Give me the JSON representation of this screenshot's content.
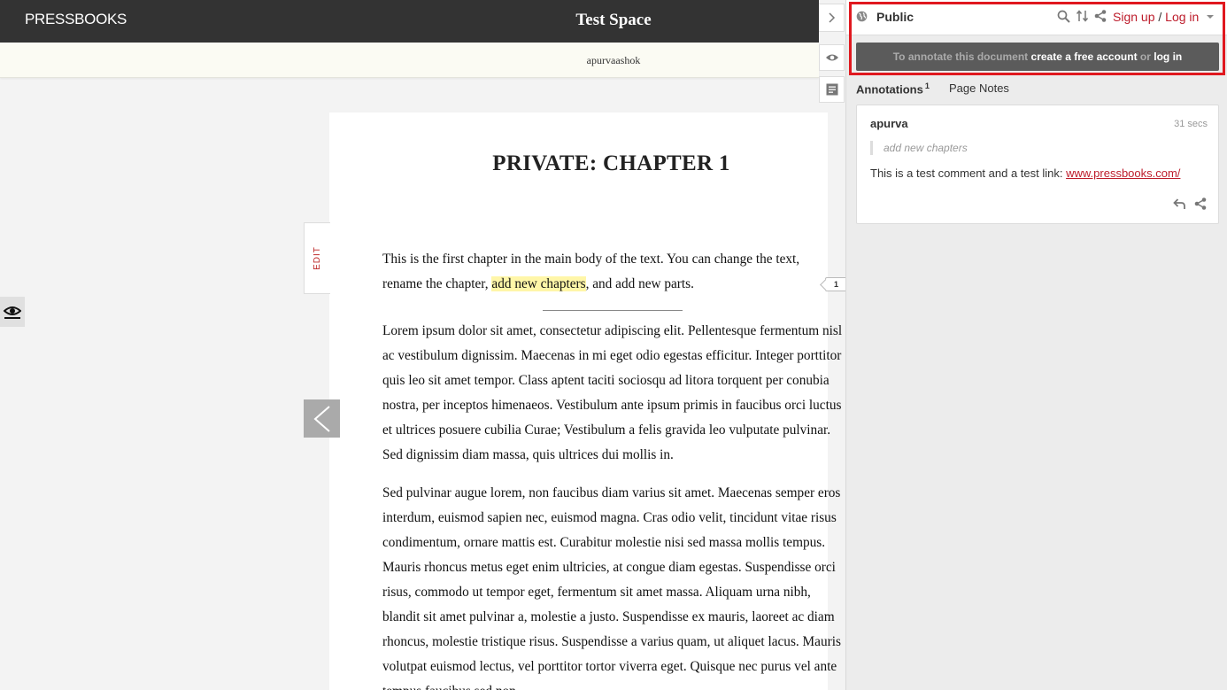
{
  "header": {
    "brand": "PRESSBOOKS",
    "site_title": "Test Space",
    "username": "apurvaashok"
  },
  "chapter": {
    "title": "PRIVATE: CHAPTER 1",
    "edit_label": "EDIT",
    "p1_before": "This is the first chapter in the main body of the text. You can change the text, rename the chapter, ",
    "p1_highlight": "add new chapters",
    "p1_after": ", and add new parts.",
    "p2": "Lorem ipsum dolor sit amet, consectetur adipiscing elit. Pellentesque fermentum nisl ac vestibulum dignissim. Maecenas in mi eget odio egestas efficitur. Integer porttitor quis leo sit amet tempor. Class aptent taciti sociosqu ad litora torquent per conubia nostra, per inceptos himenaeos. Vestibulum ante ipsum primis in faucibus orci luctus et ultrices posuere cubilia Curae; Vestibulum a felis gravida leo vulputate pulvinar. Sed dignissim diam massa, quis ultrices dui mollis in.",
    "p3": "Sed pulvinar augue lorem, non faucibus diam varius sit amet. Maecenas semper eros interdum, euismod sapien nec, euismod magna. Cras odio velit, tincidunt vitae risus condimentum, ornare mattis est. Curabitur molestie nisi sed massa mollis tempus. Mauris rhoncus metus eget enim ultricies, at congue diam egestas. Suspendisse orci risus, commodo ut tempor eget, fermentum sit amet massa. Aliquam urna nibh, blandit sit amet pulvinar a, molestie a justo. Suspendisse ex mauris, laoreet ac diam rhoncus, molestie tristique risus. Suspendisse a varius quam, ut aliquet lacus. Mauris volutpat euismod lectus, vel porttitor tortor viverra eget. Quisque nec purus vel ante tempus faucibus sed non"
  },
  "annotation_count": "1",
  "sidebar": {
    "scope": "Public",
    "sign_up": "Sign up",
    "slash": " / ",
    "log_in": "Log in",
    "cta_prefix": "To annotate this document ",
    "cta_create": "create a free account",
    "cta_or": " or ",
    "cta_login": "log in",
    "tab_annotations": "Annotations",
    "tab_annotations_count": "1",
    "tab_page_notes": "Page Notes",
    "card": {
      "user": "apurva",
      "time": "31 secs",
      "quote": "add new chapters",
      "text": "This is a test comment and a test link: ",
      "link": "www.pressbooks.com/"
    }
  },
  "icons": {
    "collapse": "chevron-right-icon",
    "eye": "eye-icon",
    "notes": "notes-icon",
    "globe": "globe-icon",
    "search": "search-icon",
    "sort": "sort-icon",
    "share": "share-icon",
    "reply": "reply-icon",
    "prev": "chevron-left-icon"
  },
  "colors": {
    "topbar": "#333333",
    "accent_red": "#bd1c2b",
    "highlight": "#fff6a8",
    "frame_red": "#e0181f"
  }
}
